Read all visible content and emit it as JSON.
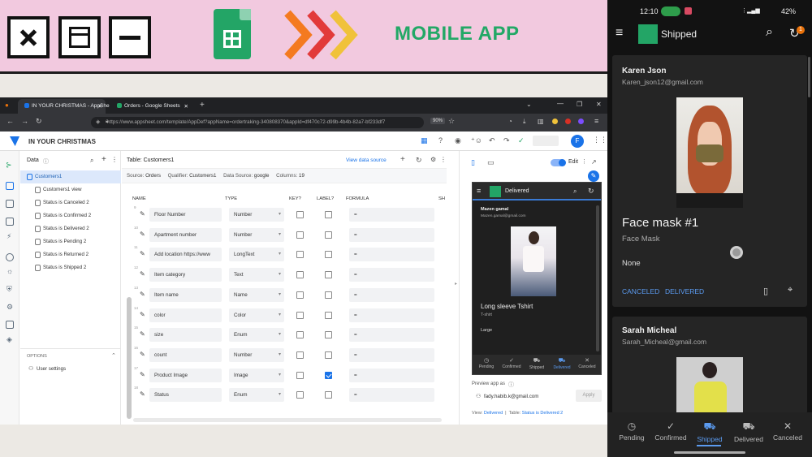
{
  "banner": {
    "title": "MOBILE APP"
  },
  "browser": {
    "tabs": [
      {
        "label": "IN YOUR CHRISTMAS - AppShe"
      },
      {
        "label": "Orders - Google Sheets"
      }
    ],
    "url": "https://www.appsheet.com/template/AppDef?appName=ordertraking-340808370&appId=df470c72-d99b-4b4b-82a7-bf233df7",
    "zoom": "90%"
  },
  "app": {
    "title": "IN YOUR CHRISTMAS",
    "avatar_letter": "F",
    "view_data_source": "View data source",
    "data_label": "Data",
    "options_label": "OPTIONS",
    "user_settings": "User settings",
    "data_items": [
      "Customers1",
      "Customers1 view",
      "Status is Canceled 2",
      "Status is Confirmed 2",
      "Status is Delivered 2",
      "Status is Pending 2",
      "Status is Returned 2",
      "Status is Shipped 2"
    ],
    "table": {
      "title": "Table: Customers1",
      "source_label": "Source:",
      "source": "Orders",
      "qualifier_label": "Qualifier:",
      "qualifier": "Customers1",
      "datasource_label": "Data Source:",
      "datasource": "google",
      "columns_label": "Columns:",
      "columns": "19",
      "headers": [
        "NAME",
        "TYPE",
        "KEY?",
        "LABEL?",
        "FORMULA",
        "SH"
      ],
      "rows": [
        {
          "num": "9",
          "name": "Floor Number",
          "type": "Number",
          "label": false
        },
        {
          "num": "10",
          "name": "Apartment number",
          "type": "Number",
          "label": false
        },
        {
          "num": "11",
          "name": "Add location  https://www",
          "type": "LongText",
          "label": false
        },
        {
          "num": "12",
          "name": "Item category",
          "type": "Text",
          "label": false
        },
        {
          "num": "13",
          "name": "Item name",
          "type": "Name",
          "label": false
        },
        {
          "num": "14",
          "name": "color",
          "type": "Color",
          "label": false
        },
        {
          "num": "15",
          "name": "size",
          "type": "Enum",
          "label": false
        },
        {
          "num": "16",
          "name": "count",
          "type": "Number",
          "label": false
        },
        {
          "num": "17",
          "name": "Product Image",
          "type": "Image",
          "label": true
        },
        {
          "num": "18",
          "name": "Status",
          "type": "Enum",
          "label": false
        }
      ],
      "formula_sign": "="
    },
    "preview": {
      "edit_label": "Edit",
      "frame_title": "Delivered",
      "customer_name": "Mazen gamal",
      "customer_email": "Mazen.gamal@gmail.com",
      "product_name": "Long sleeve Tshirt",
      "product_category": "T-shirt",
      "product_size": "Large",
      "nav": [
        "Pending",
        "Confirmed",
        "Shipped",
        "Delivered",
        "Canceled"
      ],
      "preview_as_label": "Preview app as",
      "preview_email": "fady.habib.k@gmail.com",
      "apply": "Apply",
      "footer_view_label": "View:",
      "footer_view": "Delivered",
      "footer_table_label": "Table:",
      "footer_table": "Status is Delivered 2"
    }
  },
  "phone": {
    "time": "12:10",
    "battery": "42%",
    "title": "Shipped",
    "badge": "1",
    "card1": {
      "name": "Karen Json",
      "email": "Karen_json12@gmail.com",
      "product": "Face mask #1",
      "category": "Face Mask",
      "size": "None",
      "actions": [
        "CANCELED",
        "DELIVERED"
      ]
    },
    "card2": {
      "name": "Sarah Micheal",
      "email": "Sarah_Micheal@gmail.com"
    },
    "nav": [
      "Pending",
      "Confirmed",
      "Shipped",
      "Delivered",
      "Canceled"
    ]
  },
  "colors": {
    "banner_bg": "#f2c9df",
    "sheets_green": "#23a566",
    "appsheet_blue": "#1a73e8",
    "phone_accent": "#5b9bf0"
  }
}
